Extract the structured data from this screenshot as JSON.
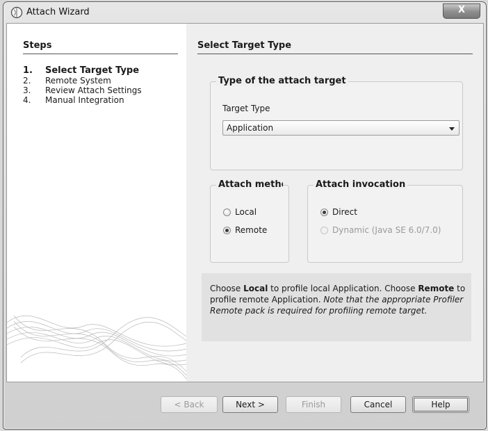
{
  "window": {
    "title": "Attach Wizard",
    "close_label": "X"
  },
  "steps": {
    "title": "Steps",
    "items": [
      {
        "num": "1.",
        "label": "Select Target Type",
        "current": true
      },
      {
        "num": "2.",
        "label": "Remote System",
        "current": false
      },
      {
        "num": "3.",
        "label": "Review Attach Settings",
        "current": false
      },
      {
        "num": "4.",
        "label": "Manual Integration",
        "current": false
      }
    ]
  },
  "main": {
    "title": "Select Target Type",
    "target_group": {
      "legend": "Type of the attach target",
      "field_label": "Target Type",
      "selected_value": "Application"
    },
    "method_group": {
      "legend": "Attach method",
      "options": [
        {
          "label": "Local",
          "checked": false
        },
        {
          "label": "Remote",
          "checked": true
        }
      ]
    },
    "invocation_group": {
      "legend": "Attach invocation",
      "options": [
        {
          "label": "Direct",
          "checked": true,
          "disabled": false
        },
        {
          "label": "Dynamic (Java SE 6.0/7.0)",
          "checked": false,
          "disabled": true
        }
      ]
    },
    "info": {
      "part1": "Choose ",
      "local": "Local",
      "part2": " to profile local Application. Choose ",
      "remote": "Remote",
      "part3": " to profile remote Application. ",
      "note": "Note that the appropriate Profiler Remote pack is required for profiling remote target."
    }
  },
  "buttons": {
    "back": "< Back",
    "next": "Next >",
    "finish": "Finish",
    "cancel": "Cancel",
    "help": "Help"
  }
}
